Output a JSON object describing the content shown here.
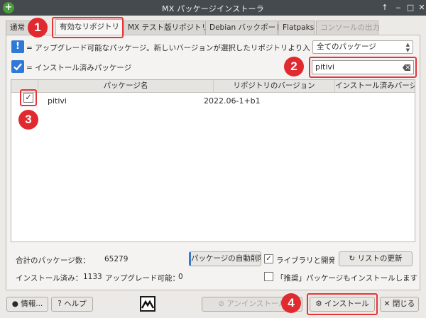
{
  "window": {
    "title": "MX パッケージインストーラ"
  },
  "tabs": [
    {
      "label": "通常"
    },
    {
      "label": "有効なリポジトリ"
    },
    {
      "label": "MX テスト版リポジトリ"
    },
    {
      "label": "Debian バックポート"
    },
    {
      "label": "Flatpaks"
    },
    {
      "label": "コンソールの出力"
    }
  ],
  "legend": {
    "upgradable": "= アップグレード可能なパッケージ。新しいバージョンが選択したリポジトリより入手できます",
    "installed": "= インストール済みパッケージ"
  },
  "filter": {
    "selected": "全てのパッケージ"
  },
  "search": {
    "value": "pitivi"
  },
  "table": {
    "columns": [
      "パッケージ名",
      "リポジトリのバージョン",
      "インストール済みバージョン"
    ],
    "rows": [
      {
        "checked": true,
        "name": "pitivi",
        "repo_version": "2022.06-1+b1",
        "installed_version": ""
      }
    ]
  },
  "stats": {
    "total_label": "合計のパッケージ数：",
    "total_value": "65279",
    "installed_label": "インストール済み：",
    "installed_value": "1133",
    "upgradable_label": "アップグレード可能：",
    "upgradable_value": "0"
  },
  "options": {
    "auto_remove": "パッケージの自動削除",
    "libs_dev": "ライブラリと開発",
    "refresh": "リストの更新",
    "recommends": "「推奨」パッケージもインストールします"
  },
  "buttons": {
    "info": "情報...",
    "help": "ヘルプ",
    "uninstall": "アンインストール",
    "install": "インストール",
    "close": "閉じる"
  },
  "callouts": [
    "1",
    "2",
    "3",
    "4"
  ],
  "colors": {
    "callout": "#e02a2f",
    "accent": "#2f7ad6",
    "titlebar": "#454a4f"
  }
}
